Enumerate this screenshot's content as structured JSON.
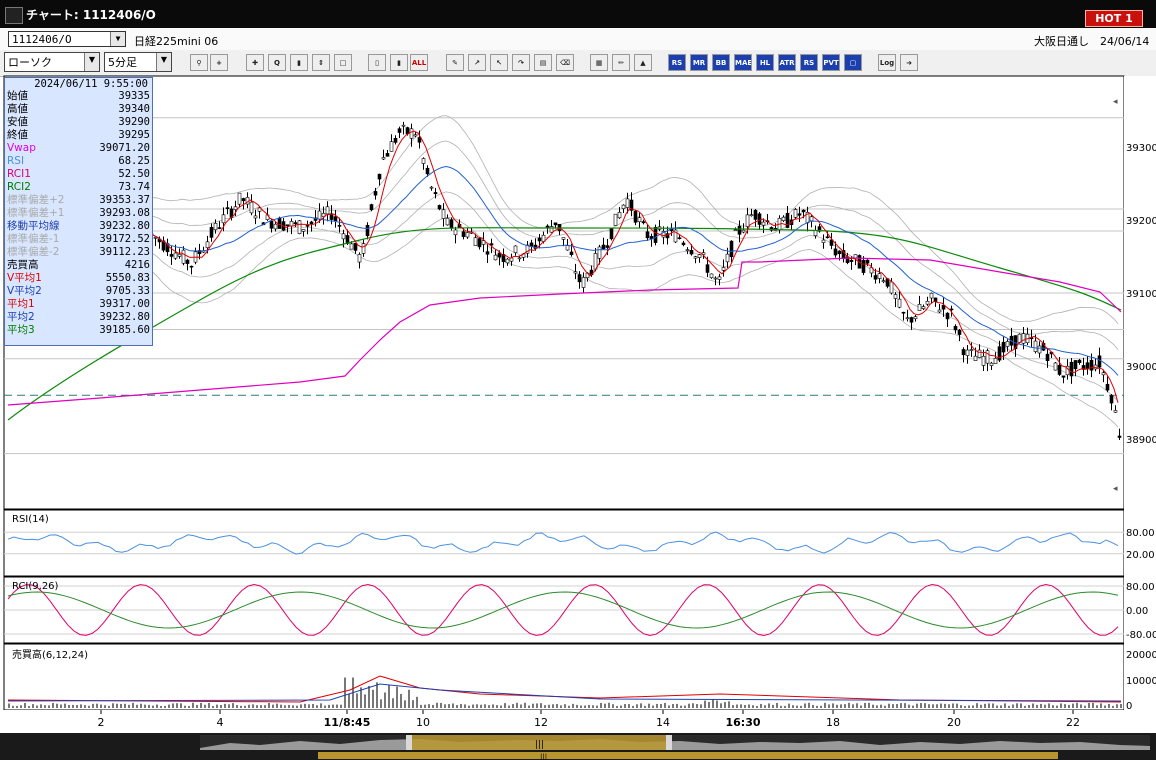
{
  "window": {
    "title": "チャート: 1112406/O",
    "hot_label": "HOT 1"
  },
  "symbol": {
    "code": "1112406/O",
    "name": "日経225mini 06",
    "session": "大阪日通し　24/06/14"
  },
  "toolbar": {
    "chart_type": "ローソク",
    "interval": "5分足",
    "text_buttons": [
      "ALL",
      "MR",
      "BB",
      "MAE",
      "HL",
      "ATR",
      "RS",
      "PVT",
      "Log"
    ]
  },
  "info_panel": {
    "datetime": "2024/06/11 9:55:00",
    "rows": [
      {
        "label": "始値",
        "value": "39335",
        "color": "#000000"
      },
      {
        "label": "高値",
        "value": "39340",
        "color": "#000000"
      },
      {
        "label": "安値",
        "value": "39290",
        "color": "#000000"
      },
      {
        "label": "終値",
        "value": "39295",
        "color": "#000000"
      },
      {
        "label": "Vwap",
        "value": "39071.20",
        "color": "#e000e0"
      },
      {
        "label": "RSI",
        "value": "68.25",
        "color": "#4a90e2"
      },
      {
        "label": "RCI1",
        "value": "52.50",
        "color": "#e0006a"
      },
      {
        "label": "RCI2",
        "value": "73.74",
        "color": "#007a00"
      },
      {
        "label": "標準偏差+2",
        "value": "39353.37",
        "color": "#aaaaaa"
      },
      {
        "label": "標準偏差+1",
        "value": "39293.08",
        "color": "#aaaaaa"
      },
      {
        "label": "移動平均線",
        "value": "39232.80",
        "color": "#1f3fb0"
      },
      {
        "label": "標準偏差-1",
        "value": "39172.52",
        "color": "#aaaaaa"
      },
      {
        "label": "標準偏差-2",
        "value": "39112.23",
        "color": "#aaaaaa"
      },
      {
        "label": "売買高",
        "value": "4216",
        "color": "#000000"
      },
      {
        "label": "V平均1",
        "value": "5550.83",
        "color": "#e00000"
      },
      {
        "label": "V平均2",
        "value": "9705.33",
        "color": "#1f3fb0"
      },
      {
        "label": "平均1",
        "value": "39317.00",
        "color": "#e00000"
      },
      {
        "label": "平均2",
        "value": "39232.80",
        "color": "#1f3fb0"
      },
      {
        "label": "平均3",
        "value": "39185.60",
        "color": "#007a00"
      }
    ]
  },
  "price_axis": [
    "39300",
    "39200",
    "39100",
    "39000",
    "38900"
  ],
  "rsi_panel": {
    "title": "RSI(14)",
    "axis": [
      "80.00",
      "20.00"
    ]
  },
  "rci_panel": {
    "title": "RCI(9,26)",
    "axis": [
      "80.00",
      "0.00",
      "-80.00"
    ]
  },
  "vol_panel": {
    "title": "売買高(6,12,24)",
    "axis": [
      "20000",
      "10000",
      "0"
    ]
  },
  "time_axis": [
    "2",
    "4",
    "11/8:45",
    "10",
    "12",
    "14",
    "16:30",
    "18",
    "20",
    "22"
  ],
  "colors": {
    "up": "#ffffff",
    "down": "#000000",
    "ma_short": "#e00000",
    "ma_mid": "#1f5fd0",
    "ma_long": "#0a8a0a",
    "vwap": "#e000c0",
    "band": "#b0b0b0",
    "rsi": "#4a90e2",
    "rci1": "#e0006a",
    "rci2": "#2a8a2a",
    "volume": "#777777"
  }
}
